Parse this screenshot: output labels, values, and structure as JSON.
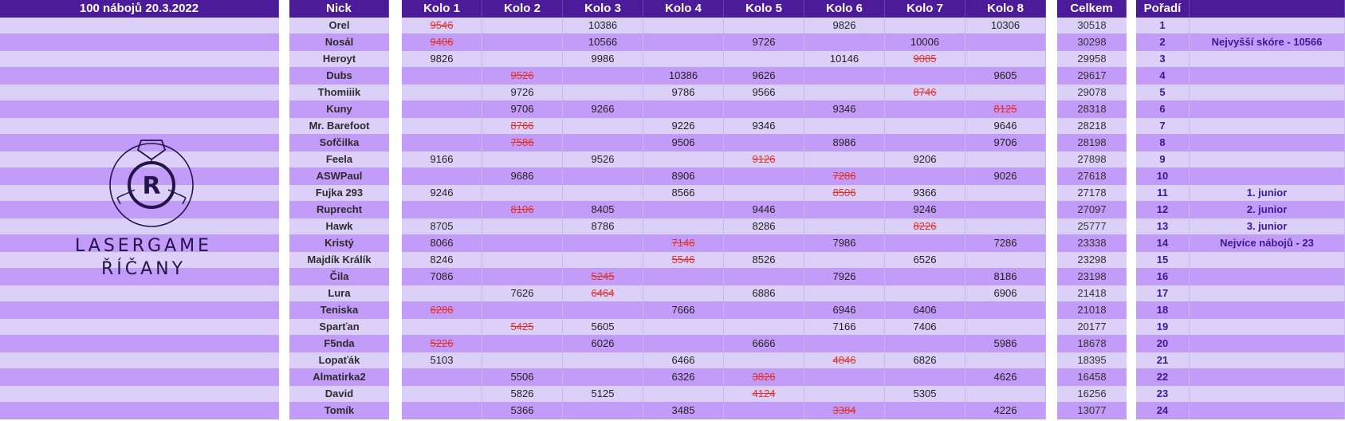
{
  "left_panel": {
    "title": "100 nábojů 20.3.2022",
    "logo_line1": "LASERGAME",
    "logo_line2": "ŘÍČANY",
    "logo_letter": "R"
  },
  "headers": {
    "nick": "Nick",
    "rounds": [
      "Kolo 1",
      "Kolo 2",
      "Kolo 3",
      "Kolo 4",
      "Kolo 5",
      "Kolo 6",
      "Kolo 7",
      "Kolo 8"
    ],
    "total": "Celkem",
    "rank": "Pořadí"
  },
  "colors": {
    "header_bg": "#4b1b9a",
    "row_light": "#ddd0f8",
    "row_dark": "#c39bf8",
    "strike": "#e0322b"
  },
  "rows": [
    {
      "nick": "Orel",
      "scores": [
        {
          "v": "9546",
          "s": true
        },
        null,
        {
          "v": "10386"
        },
        null,
        null,
        {
          "v": "9826"
        },
        null,
        {
          "v": "10306"
        }
      ],
      "total": "30518",
      "rank": "1",
      "note": ""
    },
    {
      "nick": "Nosál",
      "scores": [
        {
          "v": "9406",
          "s": true
        },
        null,
        {
          "v": "10566"
        },
        null,
        {
          "v": "9726"
        },
        null,
        {
          "v": "10006"
        },
        null
      ],
      "total": "30298",
      "rank": "2",
      "note": "Nejvyšší skóre - 10566"
    },
    {
      "nick": "Heroyt",
      "scores": [
        {
          "v": "9826"
        },
        null,
        {
          "v": "9986"
        },
        null,
        null,
        {
          "v": "10146"
        },
        {
          "v": "9085",
          "s": true
        },
        null
      ],
      "total": "29958",
      "rank": "3",
      "note": ""
    },
    {
      "nick": "Dubs",
      "scores": [
        null,
        {
          "v": "9526",
          "s": true
        },
        null,
        {
          "v": "10386"
        },
        {
          "v": "9626"
        },
        null,
        null,
        {
          "v": "9605"
        }
      ],
      "total": "29617",
      "rank": "4",
      "note": ""
    },
    {
      "nick": "Thomiiik",
      "scores": [
        null,
        {
          "v": "9726"
        },
        null,
        {
          "v": "9786"
        },
        {
          "v": "9566"
        },
        null,
        {
          "v": "8746",
          "s": true
        },
        null
      ],
      "total": "29078",
      "rank": "5",
      "note": ""
    },
    {
      "nick": "Kuny",
      "scores": [
        null,
        {
          "v": "9706"
        },
        {
          "v": "9266"
        },
        null,
        null,
        {
          "v": "9346"
        },
        null,
        {
          "v": "8125",
          "s": true
        }
      ],
      "total": "28318",
      "rank": "6",
      "note": ""
    },
    {
      "nick": "Mr. Barefoot",
      "scores": [
        null,
        {
          "v": "8766",
          "s": true
        },
        null,
        {
          "v": "9226"
        },
        {
          "v": "9346"
        },
        null,
        null,
        {
          "v": "9646"
        }
      ],
      "total": "28218",
      "rank": "7",
      "note": ""
    },
    {
      "nick": "Sofčilka",
      "scores": [
        null,
        {
          "v": "7586",
          "s": true
        },
        null,
        {
          "v": "9506"
        },
        null,
        {
          "v": "8986"
        },
        null,
        {
          "v": "9706"
        }
      ],
      "total": "28198",
      "rank": "8",
      "note": ""
    },
    {
      "nick": "Feela",
      "scores": [
        {
          "v": "9166"
        },
        null,
        {
          "v": "9526"
        },
        null,
        {
          "v": "9126",
          "s": true
        },
        null,
        {
          "v": "9206"
        },
        null
      ],
      "total": "27898",
      "rank": "9",
      "note": ""
    },
    {
      "nick": "ASWPaul",
      "scores": [
        null,
        {
          "v": "9686"
        },
        null,
        {
          "v": "8906"
        },
        null,
        {
          "v": "7286",
          "s": true
        },
        null,
        {
          "v": "9026"
        }
      ],
      "total": "27618",
      "rank": "10",
      "note": ""
    },
    {
      "nick": "Fujka 293",
      "scores": [
        {
          "v": "9246"
        },
        null,
        null,
        {
          "v": "8566"
        },
        null,
        {
          "v": "8506",
          "s": true
        },
        {
          "v": "9366"
        },
        null
      ],
      "total": "27178",
      "rank": "11",
      "note": "1. junior"
    },
    {
      "nick": "Ruprecht",
      "scores": [
        null,
        {
          "v": "8106",
          "s": true
        },
        {
          "v": "8405"
        },
        null,
        {
          "v": "9446"
        },
        null,
        {
          "v": "9246"
        },
        null
      ],
      "total": "27097",
      "rank": "12",
      "note": "2. junior"
    },
    {
      "nick": "Hawk",
      "scores": [
        {
          "v": "8705"
        },
        null,
        {
          "v": "8786"
        },
        null,
        {
          "v": "8286"
        },
        null,
        {
          "v": "8226",
          "s": true
        },
        null
      ],
      "total": "25777",
      "rank": "13",
      "note": "3. junior"
    },
    {
      "nick": "Kristý",
      "scores": [
        {
          "v": "8066"
        },
        null,
        null,
        {
          "v": "7146",
          "s": true
        },
        null,
        {
          "v": "7986"
        },
        null,
        {
          "v": "7286"
        }
      ],
      "total": "23338",
      "rank": "14",
      "note": "Nejvíce nábojů - 23"
    },
    {
      "nick": "Majdík Králík",
      "scores": [
        {
          "v": "8246"
        },
        null,
        null,
        {
          "v": "5546",
          "s": true
        },
        {
          "v": "8526"
        },
        null,
        {
          "v": "6526"
        },
        null
      ],
      "total": "23298",
      "rank": "15",
      "note": ""
    },
    {
      "nick": "Čila",
      "scores": [
        {
          "v": "7086"
        },
        null,
        {
          "v": "5245",
          "s": true
        },
        null,
        null,
        {
          "v": "7926"
        },
        null,
        {
          "v": "8186"
        }
      ],
      "total": "23198",
      "rank": "16",
      "note": ""
    },
    {
      "nick": "Lura",
      "scores": [
        null,
        {
          "v": "7626"
        },
        {
          "v": "6464",
          "s": true
        },
        null,
        {
          "v": "6886"
        },
        null,
        null,
        {
          "v": "6906"
        }
      ],
      "total": "21418",
      "rank": "17",
      "note": ""
    },
    {
      "nick": "Teniska",
      "scores": [
        {
          "v": "6286",
          "s": true
        },
        null,
        null,
        {
          "v": "7666"
        },
        null,
        {
          "v": "6946"
        },
        {
          "v": "6406"
        },
        null
      ],
      "total": "21018",
      "rank": "18",
      "note": ""
    },
    {
      "nick": "Sparťan",
      "scores": [
        null,
        {
          "v": "5425",
          "s": true
        },
        {
          "v": "5605"
        },
        null,
        null,
        {
          "v": "7166"
        },
        {
          "v": "7406"
        },
        null
      ],
      "total": "20177",
      "rank": "19",
      "note": ""
    },
    {
      "nick": "F5nda",
      "scores": [
        {
          "v": "5226",
          "s": true
        },
        null,
        {
          "v": "6026"
        },
        null,
        {
          "v": "6666"
        },
        null,
        null,
        {
          "v": "5986"
        }
      ],
      "total": "18678",
      "rank": "20",
      "note": ""
    },
    {
      "nick": "Lopaťák",
      "scores": [
        {
          "v": "5103"
        },
        null,
        null,
        {
          "v": "6466"
        },
        null,
        {
          "v": "4846",
          "s": true
        },
        {
          "v": "6826"
        },
        null
      ],
      "total": "18395",
      "rank": "21",
      "note": ""
    },
    {
      "nick": "Almatirka2",
      "scores": [
        null,
        {
          "v": "5506"
        },
        null,
        {
          "v": "6326"
        },
        {
          "v": "3826",
          "s": true
        },
        null,
        null,
        {
          "v": "4626"
        }
      ],
      "total": "16458",
      "rank": "22",
      "note": ""
    },
    {
      "nick": "David",
      "scores": [
        null,
        {
          "v": "5826"
        },
        {
          "v": "5125"
        },
        null,
        {
          "v": "4124",
          "s": true
        },
        null,
        {
          "v": "5305"
        },
        null
      ],
      "total": "16256",
      "rank": "23",
      "note": ""
    },
    {
      "nick": "Tomík",
      "scores": [
        null,
        {
          "v": "5366"
        },
        null,
        {
          "v": "3485"
        },
        null,
        {
          "v": "3384",
          "s": true
        },
        null,
        {
          "v": "4226"
        }
      ],
      "total": "13077",
      "rank": "24",
      "note": ""
    }
  ]
}
